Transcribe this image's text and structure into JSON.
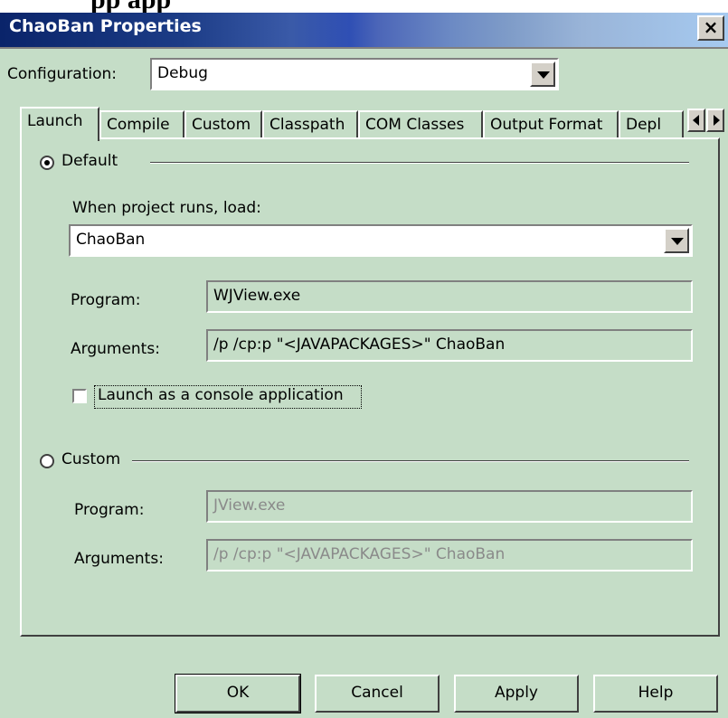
{
  "top_fragment": "pp   app",
  "window": {
    "title": "ChaoBan Properties",
    "close_glyph": "×"
  },
  "configuration": {
    "label": "Configuration:",
    "value": "Debug"
  },
  "tabs": [
    {
      "label": "Launch"
    },
    {
      "label": "Compile"
    },
    {
      "label": "Custom"
    },
    {
      "label": "Classpath"
    },
    {
      "label": "COM Classes"
    },
    {
      "label": "Output Format"
    },
    {
      "label": "Depl"
    }
  ],
  "default_section": {
    "radio_label": "Default",
    "selected": true,
    "load_label": "When project runs, load:",
    "load_value": "ChaoBan",
    "program_label": "Program:",
    "program_value": "WJView.exe",
    "arguments_label": "Arguments:",
    "arguments_value": "/p /cp:p \"<JAVAPACKAGES>\" ChaoBan",
    "console_label": "Launch as a console application",
    "console_checked": false
  },
  "custom_section": {
    "radio_label": "Custom",
    "selected": false,
    "program_label": "Program:",
    "program_value": "JView.exe",
    "arguments_label": "Arguments:",
    "arguments_value": "/p /cp:p \"<JAVAPACKAGES>\" ChaoBan"
  },
  "buttons": {
    "ok": "OK",
    "cancel": "Cancel",
    "apply": "Apply",
    "help": "Help"
  }
}
